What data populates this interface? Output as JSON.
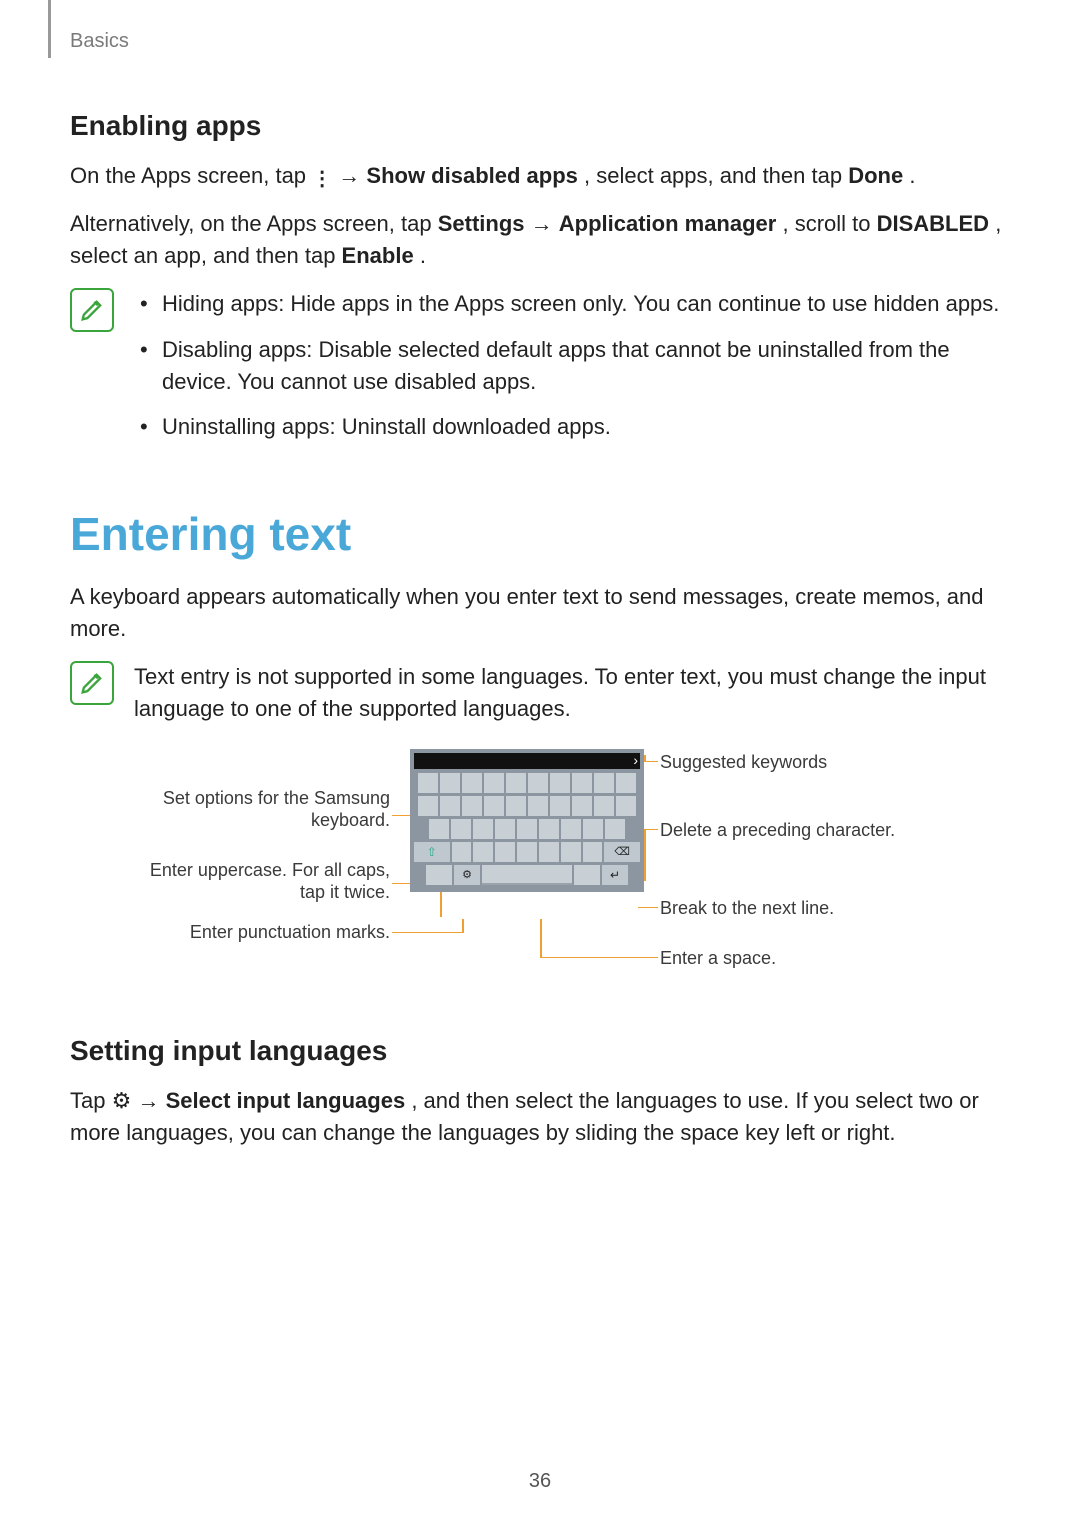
{
  "header": {
    "section_label": "Basics"
  },
  "page_number": "36",
  "enabling_apps": {
    "heading": "Enabling apps",
    "p1_a": "On the Apps screen, tap ",
    "p1_b": " → ",
    "p1_bold1": "Show disabled apps",
    "p1_c": ", select apps, and then tap ",
    "p1_bold2": "Done",
    "p1_d": ".",
    "p2_a": "Alternatively, on the Apps screen, tap ",
    "p2_bold1": "Settings",
    "p2_b": " → ",
    "p2_bold2": "Application manager",
    "p2_c": ", scroll to ",
    "p2_bold3": "DISABLED",
    "p2_d": ", select an app, and then tap ",
    "p2_bold4": "Enable",
    "p2_e": ".",
    "note_bullets": [
      "Hiding apps: Hide apps in the Apps screen only. You can continue to use hidden apps.",
      "Disabling apps: Disable selected default apps that cannot be uninstalled from the device. You cannot use disabled apps.",
      "Uninstalling apps: Uninstall downloaded apps."
    ]
  },
  "entering_text": {
    "heading": "Entering text",
    "intro": "A keyboard appears automatically when you enter text to send messages, create memos, and more.",
    "note": "Text entry is not supported in some languages. To enter text, you must change the input language to one of the supported languages.",
    "callouts": {
      "left1": "Set options for the Samsung keyboard.",
      "left2": "Enter uppercase. For all caps, tap it twice.",
      "left3": "Enter punctuation marks.",
      "right1": "Suggested keywords",
      "right2": "Delete a preceding character.",
      "right3": "Break to the next line.",
      "right4": "Enter a space."
    }
  },
  "setting_input_languages": {
    "heading": "Setting input languages",
    "p_a": "Tap ",
    "p_b": " → ",
    "p_bold1": "Select input languages",
    "p_c": ", and then select the languages to use. If you select two or more languages, you can change the languages by sliding the space key left or right."
  }
}
